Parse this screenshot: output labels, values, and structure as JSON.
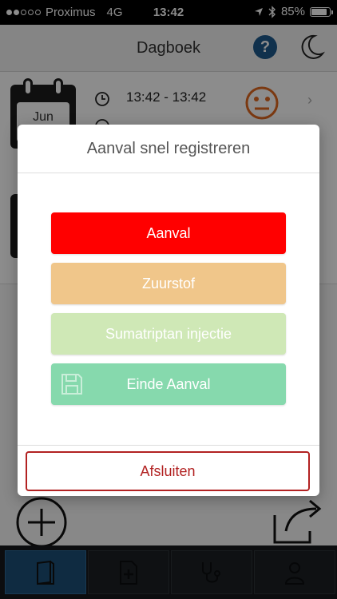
{
  "status_bar": {
    "carrier": "Proximus",
    "network": "4G",
    "time": "13:42",
    "battery": "85%",
    "battery_level": 0.85
  },
  "navbar": {
    "title": "Dagboek",
    "help_glyph": "?"
  },
  "entries": [
    {
      "month": "Jun",
      "time_range": "13:42 - 13:42"
    }
  ],
  "modal": {
    "title": "Aanval snel registreren",
    "buttons": [
      {
        "label": "Aanval",
        "color": "#ff0000"
      },
      {
        "label": "Zuurstof",
        "color": "#f0c68a"
      },
      {
        "label": "Sumatriptan injectie",
        "color": "#cfe8b6"
      },
      {
        "label": "Einde Aanval",
        "color": "#86d9ad"
      }
    ],
    "close_label": "Afsluiten"
  },
  "tabbar": {
    "items": [
      {
        "icon": "diary-book-icon",
        "active": true
      },
      {
        "icon": "medical-file-icon",
        "active": false
      },
      {
        "icon": "stethoscope-icon",
        "active": false
      },
      {
        "icon": "user-icon",
        "active": false
      }
    ]
  },
  "colors": {
    "accent": "#1d4f77",
    "danger": "#b22222",
    "face": "#e06820"
  }
}
